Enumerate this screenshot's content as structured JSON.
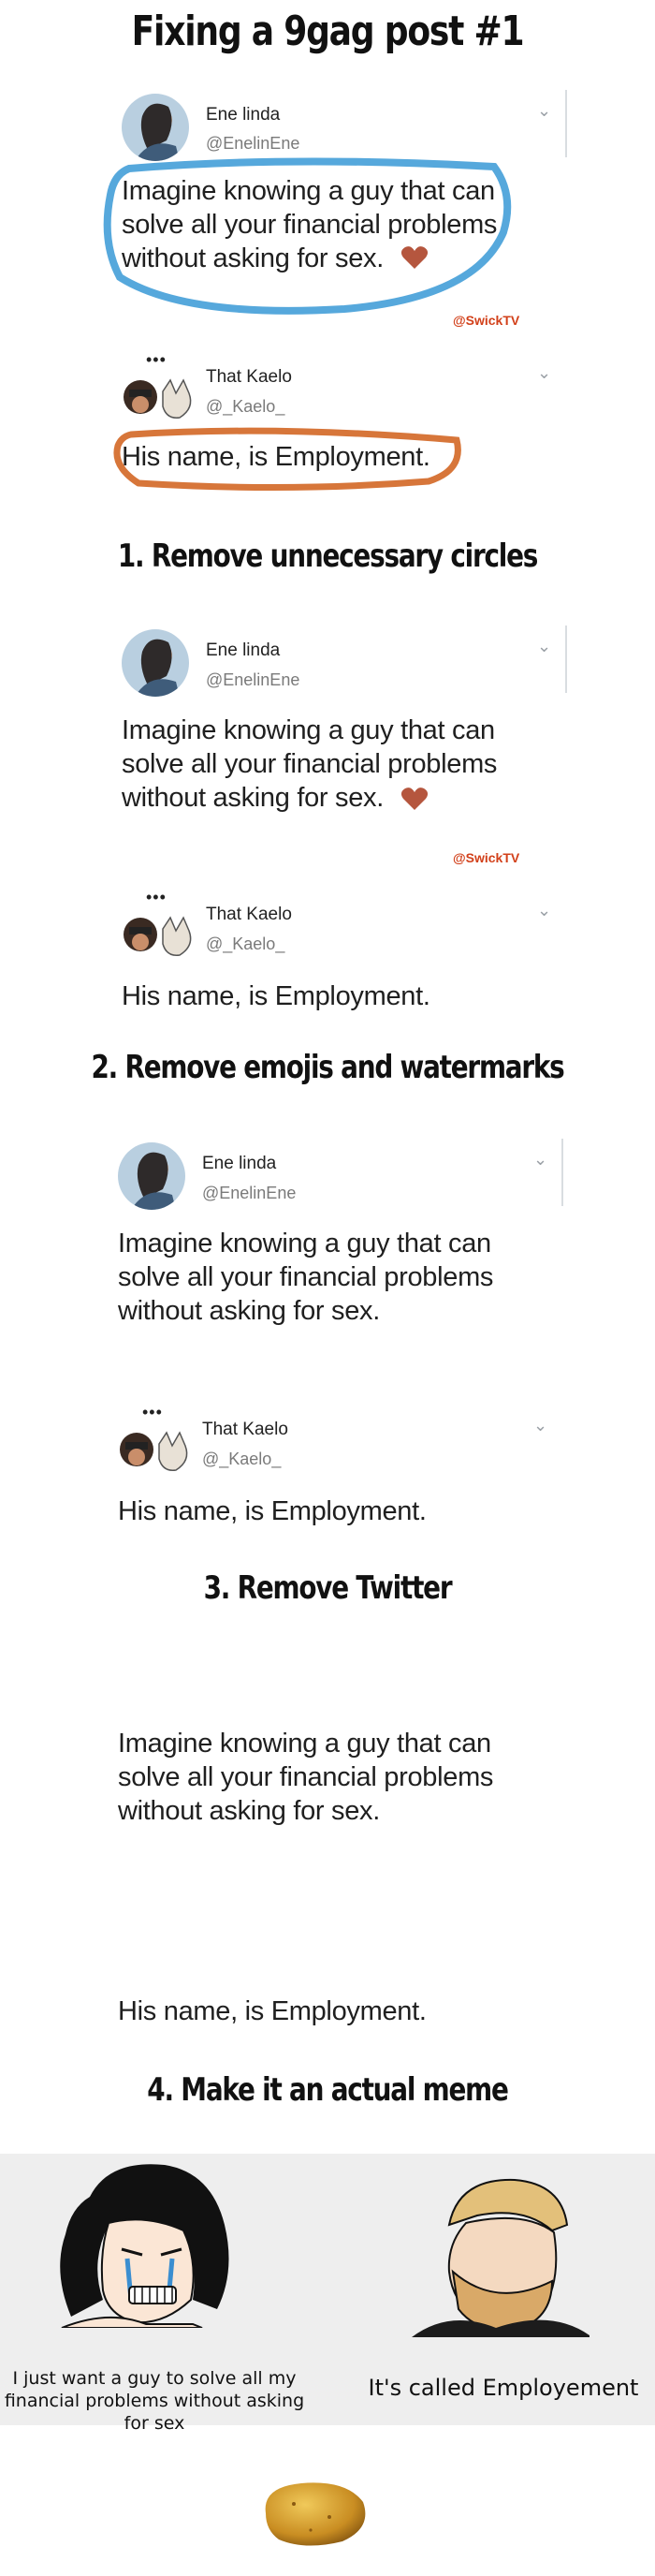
{
  "title": "Fixing a 9gag post #1",
  "steps": [
    "1. Remove unnecessary circles",
    "2. Remove emojis and watermarks",
    "3. Remove Twitter",
    "4. Make it an actual meme"
  ],
  "tweet1": {
    "name": "Ene linda",
    "handle": "@EnelinEne",
    "text_lines": [
      "Imagine knowing a guy that can",
      "solve all your financial problems",
      "without asking for sex."
    ]
  },
  "tweet2": {
    "name": "That Kaelo",
    "handle": "@_Kaelo_",
    "text": "His name, is Employment."
  },
  "watermark": "@SwickTV",
  "meme": {
    "left_caption_lines": [
      "I just want a guy to solve all my",
      "financial problems without asking",
      "for sex"
    ],
    "right_caption": "It's called Employement"
  },
  "colors": {
    "blue_circle": "#56a8dc",
    "orange_circle": "#d7763a",
    "heart": "#b5563e",
    "watermark": "#d2401a"
  },
  "icons": [
    "chevron-down-icon",
    "heart-icon",
    "more-dots-icon",
    "wojak-crying-icon",
    "chad-icon",
    "potato-icon"
  ]
}
